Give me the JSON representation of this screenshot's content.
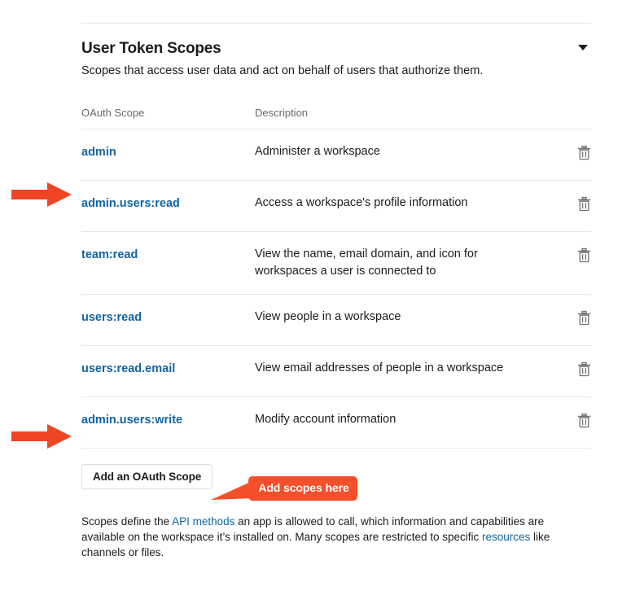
{
  "section": {
    "title": "User Token Scopes",
    "subtitle": "Scopes that access user data and act on behalf of users that authorize them.",
    "collapse_icon": "chevron-down-icon"
  },
  "table": {
    "columns": {
      "scope": "OAuth Scope",
      "description": "Description"
    },
    "rows": [
      {
        "scope": "admin",
        "description": "Administer a workspace",
        "delete_icon": "trash-icon"
      },
      {
        "scope": "admin.users:read",
        "description": "Access a workspace's profile information",
        "delete_icon": "trash-icon"
      },
      {
        "scope": "team:read",
        "description": "View the name, email domain, and icon for workspaces a user is connected to",
        "delete_icon": "trash-icon"
      },
      {
        "scope": "users:read",
        "description": "View people in a workspace",
        "delete_icon": "trash-icon"
      },
      {
        "scope": "users:read.email",
        "description": "View email addresses of people in a workspace",
        "delete_icon": "trash-icon"
      },
      {
        "scope": "admin.users:write",
        "description": "Modify account information",
        "delete_icon": "trash-icon"
      }
    ]
  },
  "add_scope_button": {
    "label": "Add an OAuth Scope"
  },
  "footnote": {
    "part1": "Scopes define the ",
    "link1": "API methods",
    "part2": " an app is allowed to call, which information and capabilities are available on the workspace it’s installed on. Many scopes are restricted to specific ",
    "link2": "resources",
    "part3": " like channels or files."
  },
  "annotations": {
    "callout_label": "Add scopes here",
    "arrow_color": "#f04524",
    "callout_color": "#f4502b",
    "arrow_1_target": "admin.users:read",
    "arrow_2_target": "admin.users:write"
  },
  "colors": {
    "link_blue": "#1264a3",
    "text": "#1d1c1d",
    "muted": "#696969",
    "divider": "#e8e8e8",
    "annotation_orange": "#f04524"
  }
}
